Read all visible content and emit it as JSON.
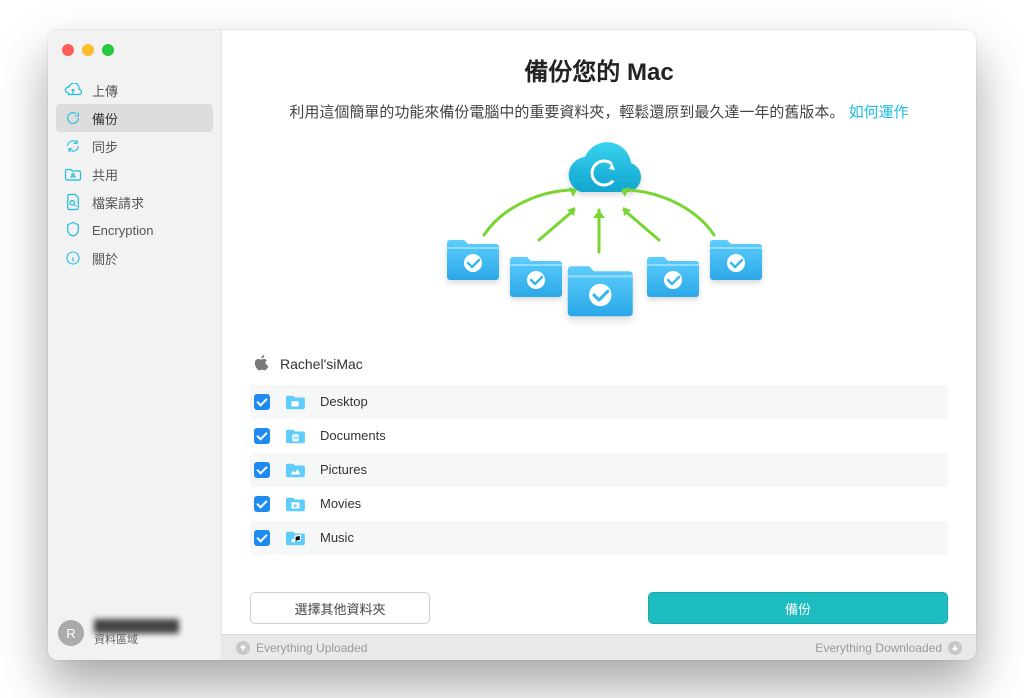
{
  "sidebar": {
    "items": [
      {
        "id": "upload",
        "label": "上傳"
      },
      {
        "id": "backup",
        "label": "備份",
        "active": true
      },
      {
        "id": "sync",
        "label": "同步"
      },
      {
        "id": "share",
        "label": "共用"
      },
      {
        "id": "filerequest",
        "label": "檔案請求"
      },
      {
        "id": "encryption",
        "label": "Encryption"
      },
      {
        "id": "about",
        "label": "關於"
      }
    ]
  },
  "footer": {
    "avatar_initial": "R",
    "username_masked": "██████████",
    "zone_label": "資料區域"
  },
  "main": {
    "title": "備份您的 Mac",
    "subtitle": "利用這個簡單的功能來備份電腦中的重要資料夾，輕鬆還原到最久達一年的舊版本。",
    "how_link": "如何運作",
    "device_name": "Rachel'siMac",
    "folders": [
      {
        "label": "Desktop",
        "checked": true
      },
      {
        "label": "Documents",
        "checked": true
      },
      {
        "label": "Pictures",
        "checked": true
      },
      {
        "label": "Movies",
        "checked": true
      },
      {
        "label": "Music",
        "checked": true
      }
    ],
    "choose_other_label": "選擇其他資料夾",
    "backup_button_label": "備份"
  },
  "statusbar": {
    "uploaded": "Everything Uploaded",
    "downloaded": "Everything Downloaded"
  },
  "colors": {
    "accent_cyan": "#1bbde0",
    "primary_button": "#1dbcc0",
    "checkbox_blue": "#1f8af0",
    "arrow_green": "#79d531"
  }
}
